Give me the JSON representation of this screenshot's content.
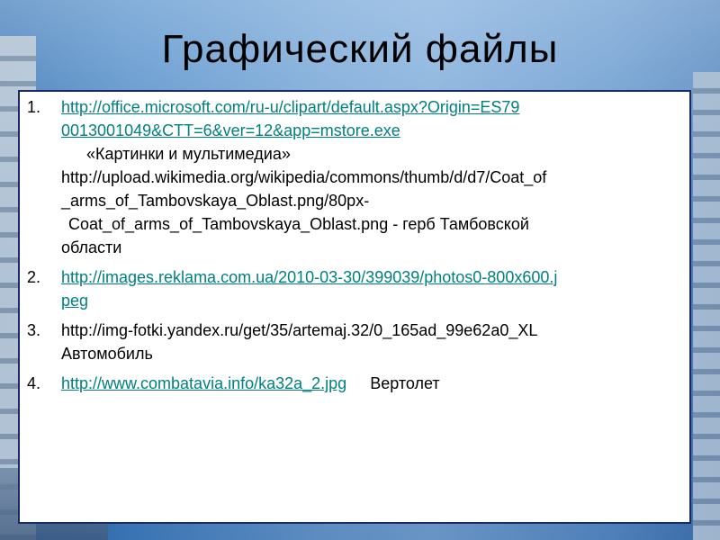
{
  "title": "Графический файлы",
  "items": [
    {
      "number": "1.",
      "link1_line1": "http://office.microsoft.com/ru-u/clipart/default.aspx?Origin=ES79",
      "link1_line2": "0013001049&CTT=6&ver=12&app=mstore.exe",
      "caption1": "«Картинки и мультимедиа»",
      "link2_line1": "http://upload.wikimedia.org/wikipedia/commons/thumb/d/d7/Coat_of",
      "link2_line2": "_arms_of_Tambovskaya_Oblast.png/80px-",
      "caption2_line1": "Coat_of_arms_of_Tambovskaya_Oblast.png - герб Тамбовской",
      "caption2_line2": "области"
    },
    {
      "number": "2.",
      "link_line1": "http://images.reklama.com.ua/2010-03-30/399039/photos0-800x600.j",
      "link_line2": "peg"
    },
    {
      "number": "3.",
      "text_line1": "http://img-fotki.yandex.ru/get/35/artemaj.32/0_165ad_99e62a0_XL",
      "text_line2": "Автомобиль"
    },
    {
      "number": "4.",
      "link": "http://www.combatavia.info/ka32a_2.jpg",
      "caption": "Вертолет"
    }
  ],
  "colors": {
    "link": "#008080",
    "panel_border": "#1a2a66",
    "background": "#6ea0d2"
  }
}
